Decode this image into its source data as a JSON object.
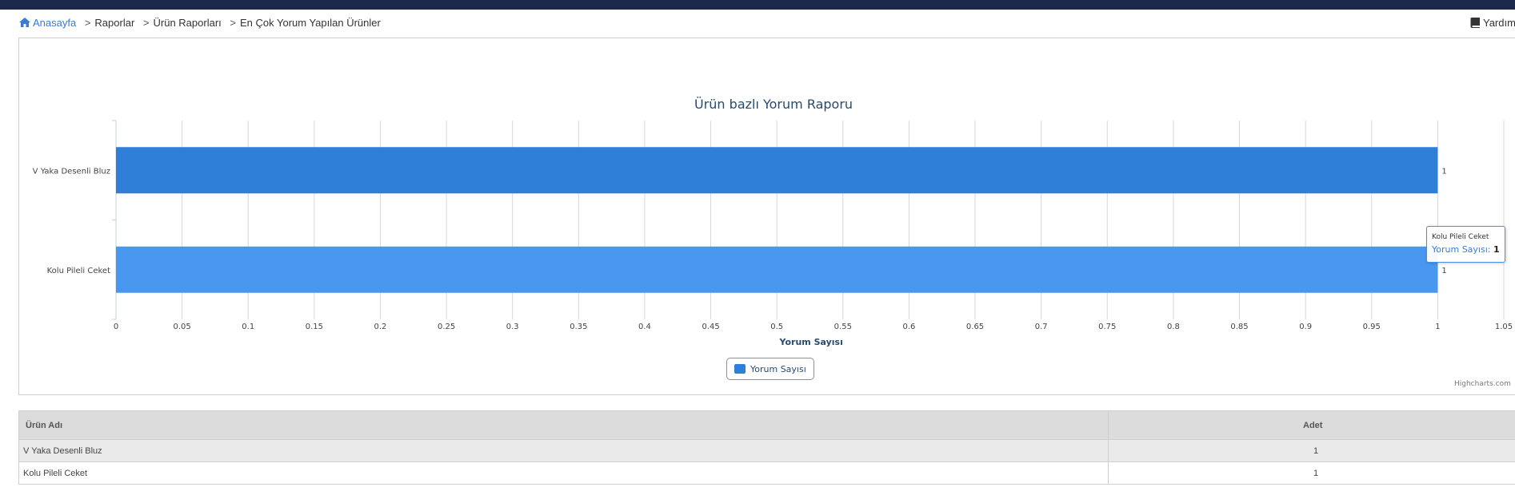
{
  "breadcrumb": {
    "home": "Anasayfa",
    "items": [
      "Raporlar",
      "Ürün Raporları",
      "En Çok Yorum Yapılan Ürünler"
    ],
    "separator": ">"
  },
  "help_label": "Yardım",
  "icons": {
    "home": "home-icon",
    "help": "book-icon"
  },
  "chart_data": {
    "type": "bar",
    "orientation": "horizontal",
    "title": "Ürün bazlı Yorum Raporu",
    "categories": [
      "V Yaka Desenli Bluz",
      "Kolu Pileli Ceket"
    ],
    "series": [
      {
        "name": "Yorum Sayısı",
        "values": [
          1,
          1
        ]
      }
    ],
    "bar_colors": [
      "#2f7ed8",
      "#4a97ef"
    ],
    "xlabel": "Yorum Sayısı",
    "ylabel": "",
    "xlim": [
      0,
      1.05
    ],
    "ticks": [
      "0",
      "0.05",
      "0.1",
      "0.15",
      "0.2",
      "0.25",
      "0.3",
      "0.35",
      "0.4",
      "0.45",
      "0.5",
      "0.55",
      "0.6",
      "0.65",
      "0.7",
      "0.75",
      "0.8",
      "0.85",
      "0.9",
      "0.95",
      "1",
      "1.05"
    ],
    "data_labels": [
      "1",
      "1"
    ],
    "grid": true,
    "legend": "bottom-center",
    "credits": "Highcharts.com"
  },
  "tooltip": {
    "title": "Kolu Pileli Ceket",
    "series": "Yorum Sayısı:",
    "value": "1"
  },
  "table": {
    "headers": [
      "Ürün Adı",
      "Adet"
    ],
    "rows": [
      {
        "name": "V Yaka Desenli Bluz",
        "qty": "1"
      },
      {
        "name": "Kolu Pileli Ceket",
        "qty": "1"
      }
    ]
  }
}
